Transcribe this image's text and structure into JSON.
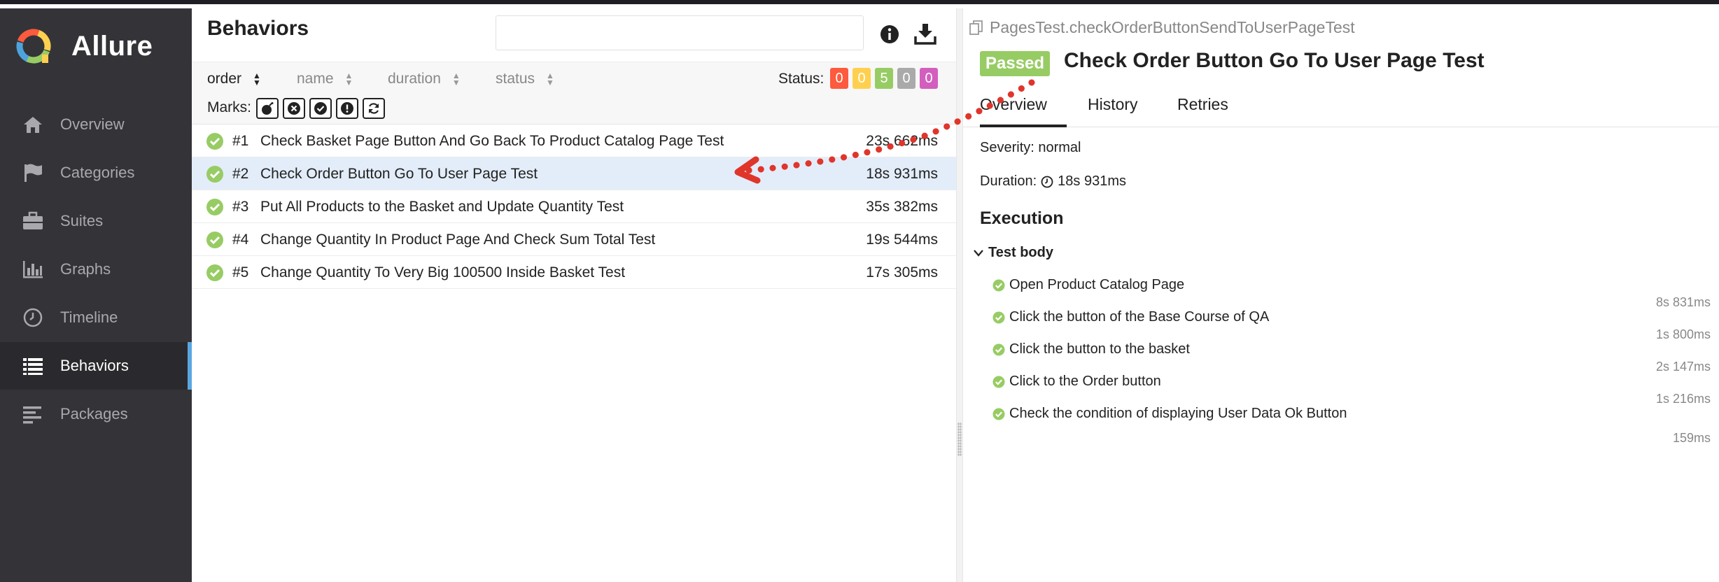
{
  "app": {
    "name": "Allure"
  },
  "sidebar": {
    "items": [
      {
        "label": "Overview",
        "icon": "home-icon"
      },
      {
        "label": "Categories",
        "icon": "flag-icon"
      },
      {
        "label": "Suites",
        "icon": "briefcase-icon"
      },
      {
        "label": "Graphs",
        "icon": "bar-chart-icon"
      },
      {
        "label": "Timeline",
        "icon": "clock-icon"
      },
      {
        "label": "Behaviors",
        "icon": "list-icon",
        "active": true
      },
      {
        "label": "Packages",
        "icon": "align-left-icon"
      }
    ]
  },
  "behaviors": {
    "title": "Behaviors",
    "search": {
      "value": "",
      "placeholder": ""
    },
    "sort": {
      "order": "order",
      "name": "name",
      "duration": "duration",
      "status": "status"
    },
    "status_label": "Status:",
    "status_counts": [
      {
        "value": "0",
        "color": "#fd5a3e"
      },
      {
        "value": "0",
        "color": "#ffd050"
      },
      {
        "value": "5",
        "color": "#97cc64"
      },
      {
        "value": "0",
        "color": "#aaaaaa"
      },
      {
        "value": "0",
        "color": "#d35ebe"
      }
    ],
    "marks_label": "Marks:",
    "marks": [
      "bomb-icon",
      "times-circle-icon",
      "check-circle-icon",
      "exclamation-circle-icon",
      "refresh-icon"
    ],
    "tests": [
      {
        "num": "#1",
        "name": "Check Basket Page Button And Go Back To Product Catalog Page Test",
        "duration": "23s 662ms"
      },
      {
        "num": "#2",
        "name": "Check Order Button Go To User Page Test",
        "duration": "18s 931ms",
        "selected": true
      },
      {
        "num": "#3",
        "name": "Put All Products to the Basket and Update Quantity Test",
        "duration": "35s 382ms"
      },
      {
        "num": "#4",
        "name": "Change Quantity In Product Page And Check Sum Total Test",
        "duration": "19s 544ms"
      },
      {
        "num": "#5",
        "name": "Change Quantity To Very Big 100500 Inside Basket Test",
        "duration": "17s 305ms"
      }
    ]
  },
  "detail": {
    "full_name": "PagesTest.checkOrderButtonSendToUserPageTest",
    "status": "Passed",
    "title": "Check Order Button Go To User Page Test",
    "tabs": [
      "Overview",
      "History",
      "Retries"
    ],
    "severity": "Severity: normal",
    "duration_label": "Duration:",
    "duration": "18s 931ms",
    "execution_title": "Execution",
    "test_body_label": "Test body",
    "steps": [
      {
        "name": "Open Product Catalog Page",
        "duration": "8s 831ms"
      },
      {
        "name": "Click the button of the Base Course of QA",
        "duration": "1s 800ms"
      },
      {
        "name": "Click the button to the basket",
        "duration": "2s 147ms"
      },
      {
        "name": "Click to the Order button",
        "duration": "1s 216ms"
      },
      {
        "name": "Check the condition of displaying User Data Ok Button",
        "duration": "159ms"
      }
    ]
  },
  "colors": {
    "passed": "#97cc64",
    "sidebar_bg": "#343438",
    "active_accent": "#5aa6e0",
    "annotation_arrow": "#e0352b"
  }
}
